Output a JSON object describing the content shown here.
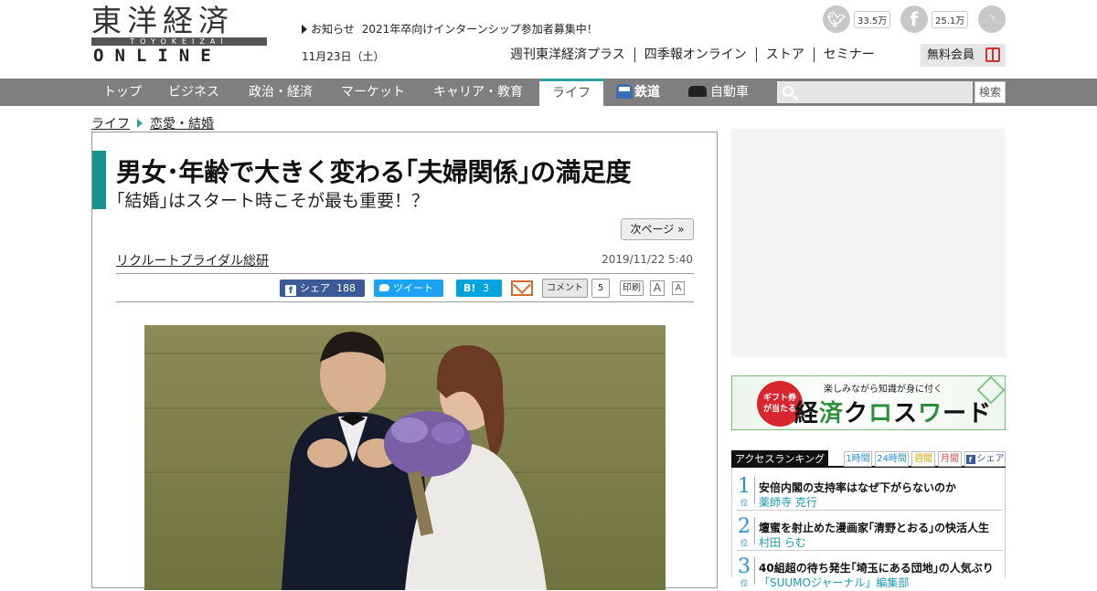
{
  "header": {
    "logo_jp": "東洋経済",
    "logo_romaji": "TOYOKEIZAI",
    "logo_online": "ONLINE",
    "notice_label": "お知らせ",
    "notice_text": "2021年卒向けインターンシップ参加者募集中！",
    "date": "11月23日（土）",
    "social": {
      "twitter_count": "33.5万",
      "facebook_count": "25.1万"
    },
    "top_links": [
      "週刊東洋経済プラス",
      "四季報オンライン",
      "ストア",
      "セミナー"
    ],
    "member_label": "無料会員"
  },
  "category_nav": {
    "items": [
      "トップ",
      "ビジネス",
      "政治・経済",
      "マーケット",
      "キャリア・教育",
      "ライフ",
      "鉄道",
      "自動車"
    ],
    "active": "ライフ",
    "active_color": "#2aa3a3",
    "search_placeholder": "",
    "search_button": "検索"
  },
  "breadcrumb": [
    "ライフ",
    "恋愛・結婚"
  ],
  "article": {
    "title": "男女･年齢で大きく変わる｢夫婦関係｣の満足度",
    "subtitle": "｢結婚｣はスタート時こそが最も重要！？",
    "next_page": "次ページ »",
    "author": "リクルートブライダル総研",
    "published": "2019/11/22 5:40",
    "share": {
      "facebook_label": "シェア",
      "facebook_count": "188",
      "twitter_label": "ツイート",
      "hatena_label": "B!",
      "hatena_count": "3",
      "comment_label": "コメント",
      "comment_count": "5",
      "print_label": "印刷",
      "font_large": "A",
      "font_small": "A"
    },
    "accent_color": "#1a9191"
  },
  "sidebar": {
    "banner": {
      "badge": "ギフト券\nが当たる",
      "tagline": "楽しみながら知識が身に付く",
      "title_a": "経",
      "title_b": "済",
      "title_c": "ク",
      "title_d": "ロ",
      "title_e": "ス",
      "title_f": "ワ",
      "title_g": "ー",
      "title_h": "ド"
    },
    "ranking": {
      "title": "アクセスランキング",
      "tabs": [
        "1時間",
        "24時間",
        "週間",
        "月間",
        "シェア"
      ],
      "items": [
        {
          "rank": "1",
          "rank_suffix": "位",
          "headline": "安倍内閣の支持率はなぜ下がらないのか",
          "author": "薬師寺 克行"
        },
        {
          "rank": "2",
          "rank_suffix": "位",
          "headline": "壇蜜を射止めた漫画家｢清野とおる｣の快活人生",
          "author": "村田 らむ"
        },
        {
          "rank": "3",
          "rank_suffix": "位",
          "headline": "40組超の待ち発生｢埼玉にある団地｣の人気ぶり",
          "author": "「SUUMOジャーナル」編集部"
        }
      ]
    }
  }
}
